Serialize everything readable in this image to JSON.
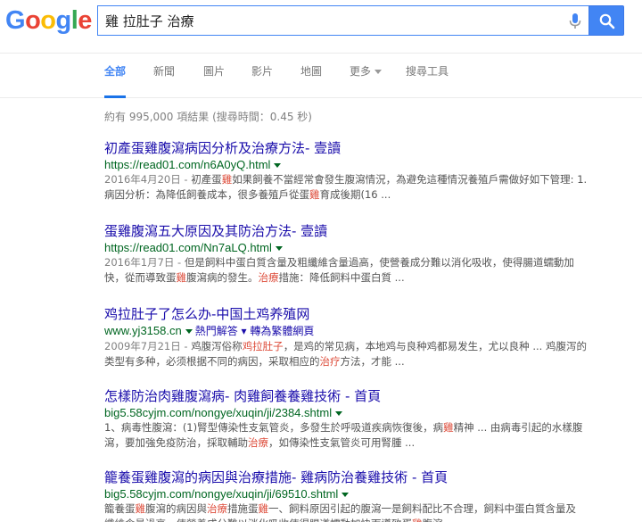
{
  "search": {
    "query": "雞 拉肚子 治療"
  },
  "logo": [
    "G",
    "o",
    "o",
    "g",
    "l",
    "e"
  ],
  "logo_colors": [
    "#4285f4",
    "#ea4335",
    "#fbbc05",
    "#4285f4",
    "#34a853",
    "#ea4335"
  ],
  "tabs": [
    {
      "label": "全部",
      "active": true
    },
    {
      "label": "新聞"
    },
    {
      "label": "圖片"
    },
    {
      "label": "影片"
    },
    {
      "label": "地圖"
    },
    {
      "label": "更多"
    },
    {
      "label": "搜尋工具"
    }
  ],
  "stats": "約有 995,000 項結果 (搜尋時間：0.45 秒)",
  "results": [
    {
      "title": "初產蛋雞腹瀉病因分析及治療方法- 壹讀",
      "url": "https://read01.com/n6A0yQ.html",
      "line1": [
        {
          "t": "2016年4月20日 - ",
          "c": "date"
        },
        {
          "t": "初產蛋"
        },
        {
          "t": "雞",
          "c": "hl"
        },
        {
          "t": "如果飼養不當經常會發生腹瀉情況，為避免這種情況養殖戶需做好如下管理: 1."
        }
      ],
      "line2": [
        {
          "t": "病因分析：為降低飼養成本，很多養殖戶從蛋"
        },
        {
          "t": "雞",
          "c": "hl"
        },
        {
          "t": "育成後期(16 ..."
        }
      ]
    },
    {
      "title": "蛋雞腹瀉五大原因及其防治方法- 壹讀",
      "url": "https://read01.com/Nn7aLQ.html",
      "line1": [
        {
          "t": "2016年1月7日 - ",
          "c": "date"
        },
        {
          "t": "但是飼料中蛋白質含量及粗纖維含量過高，使營養成分難以消化吸收，使得腸道蠕動加"
        }
      ],
      "line2": [
        {
          "t": "快，從而導致蛋"
        },
        {
          "t": "雞",
          "c": "hl"
        },
        {
          "t": "腹瀉病的發生。"
        },
        {
          "t": "治療",
          "c": "hl"
        },
        {
          "t": "措施：降低飼料中蛋白質 ..."
        }
      ]
    },
    {
      "title": "鸡拉肚子了怎么办-中国土鸡养殖网",
      "url": "www.yj3158.cn",
      "extra": "熱門解答 ▾ 轉為繁體網頁",
      "line1": [
        {
          "t": "2009年7月21日 - ",
          "c": "date"
        },
        {
          "t": "鸡腹泻俗称"
        },
        {
          "t": "鸡拉肚子",
          "c": "hl"
        },
        {
          "t": "，是鸡的常见病，本地鸡与良种鸡都易发生，尤以良种 ... 鸡腹泻的"
        }
      ],
      "line2": [
        {
          "t": "类型有多种，必须根据不同的病因，采取相应的"
        },
        {
          "t": "治疗",
          "c": "hl"
        },
        {
          "t": "方法，才能 ..."
        }
      ]
    },
    {
      "title": "怎樣防治肉雞腹瀉病- 肉雞飼養養雞技術 - 首頁",
      "url": "big5.58cyjm.com/nongye/xuqin/ji/2384.shtml",
      "line1": [
        {
          "t": "1、病毒性腹瀉：(1)腎型傳染性支氣管炎，多發生於呼吸道疾病恢復後，病"
        },
        {
          "t": "雞",
          "c": "hl"
        },
        {
          "t": "精神 ... 由病毒引起的水樣腹"
        }
      ],
      "line2": [
        {
          "t": "瀉，要加強免疫防治，採取輔助"
        },
        {
          "t": "治療",
          "c": "hl"
        },
        {
          "t": "，如傳染性支氣管炎可用腎腫 ..."
        }
      ]
    },
    {
      "title": "籠養蛋雞腹瀉的病因與治療措施- 雞病防治養雞技術 - 首頁",
      "url": "big5.58cyjm.com/nongye/xuqin/ji/69510.shtml",
      "line1": [
        {
          "t": "籠養蛋"
        },
        {
          "t": "雞",
          "c": "hl"
        },
        {
          "t": "腹瀉的病因與"
        },
        {
          "t": "治療",
          "c": "hl"
        },
        {
          "t": "措施蛋"
        },
        {
          "t": "雞",
          "c": "hl"
        },
        {
          "t": "一、飼料原因引起的腹瀉一是飼料配比不合理，飼料中蛋白質含量及"
        }
      ],
      "line2": [
        {
          "t": "纖維含量過高，使營養成分難以消化吸收使得腸道蠕動加快而導致蛋"
        },
        {
          "t": "雞",
          "c": "hl"
        },
        {
          "t": "腹瀉"
        }
      ]
    }
  ]
}
